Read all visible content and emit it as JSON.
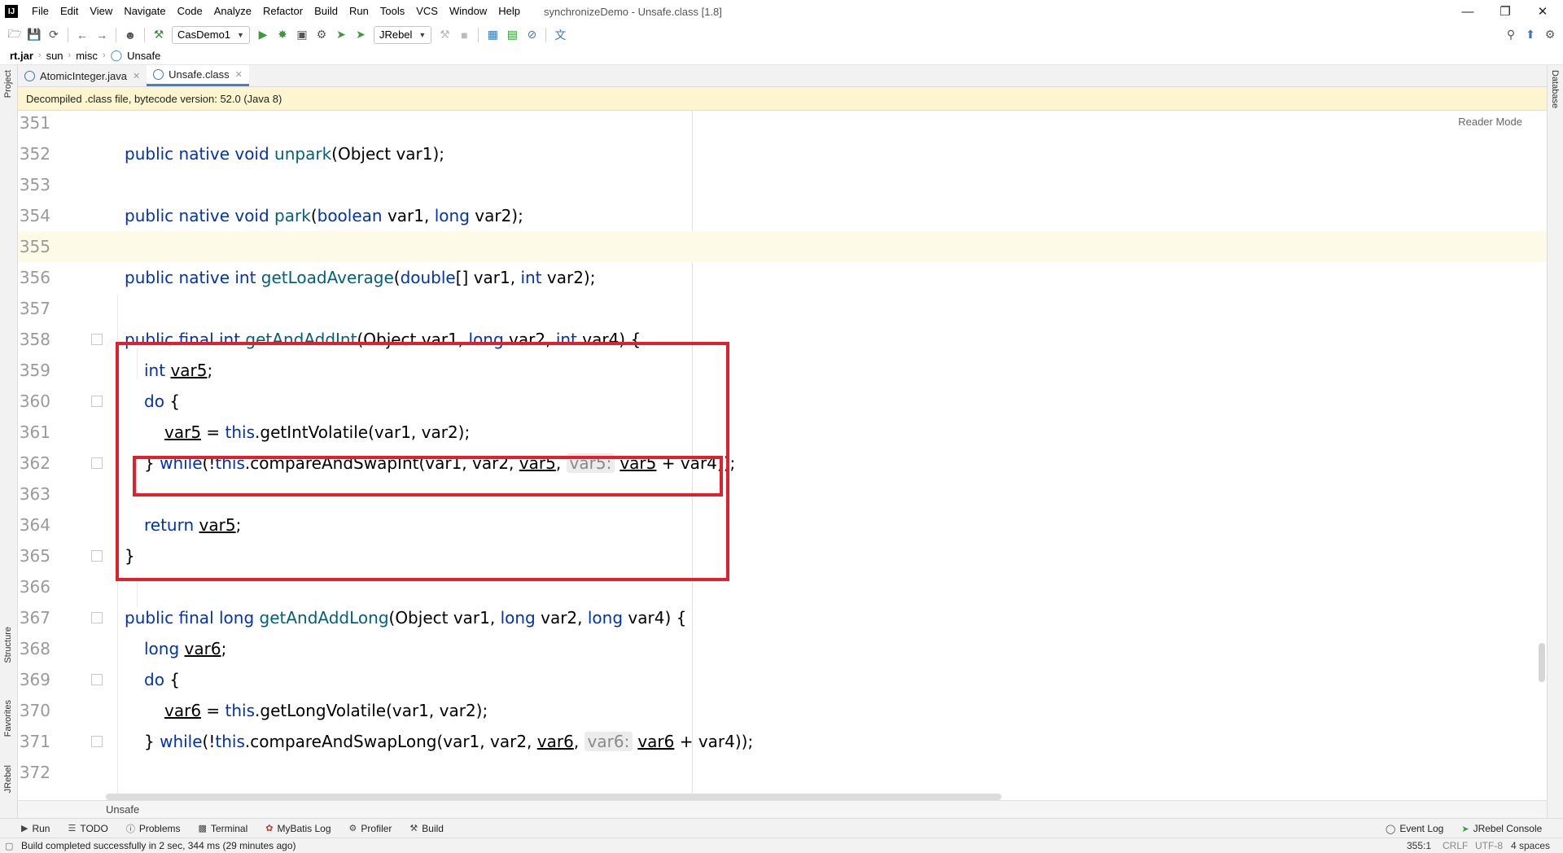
{
  "menubar": {
    "logo": "IJ",
    "items": [
      "File",
      "Edit",
      "View",
      "Navigate",
      "Code",
      "Analyze",
      "Refactor",
      "Build",
      "Run",
      "Tools",
      "VCS",
      "Window",
      "Help"
    ],
    "window_title": "synchronizeDemo - Unsafe.class [1.8]"
  },
  "toolbar": {
    "run_config": "CasDemo1",
    "jrebel_label": "JRebel"
  },
  "breadcrumb": [
    "rt.jar",
    "sun",
    "misc",
    "Unsafe"
  ],
  "tabs": [
    {
      "label": "AtomicInteger.java",
      "active": false
    },
    {
      "label": "Unsafe.class",
      "active": true
    }
  ],
  "banner": "Decompiled .class file, bytecode version: 52.0 (Java 8)",
  "reader_mode": "Reader Mode",
  "left_strip": {
    "project": "Project",
    "structure": "Structure",
    "favorites": "Favorites",
    "jrebel": "JRebel"
  },
  "right_strip": {
    "database": "Database"
  },
  "editor": {
    "line_numbers": [
      "351",
      "352",
      "353",
      "354",
      "355",
      "356",
      "357",
      "358",
      "359",
      "360",
      "361",
      "362",
      "363",
      "364",
      "365",
      "366",
      "367",
      "368",
      "369",
      "370",
      "371",
      "372"
    ],
    "lines": {
      "l352": {
        "t1": "public native void ",
        "t2": "unpark",
        "t3": "(Object var1);"
      },
      "l354": {
        "t1": "public native void ",
        "t2": "park",
        "t3": "(",
        "t4": "boolean",
        "t5": " var1, ",
        "t6": "long",
        "t7": " var2);"
      },
      "l356": {
        "t1": "public native int ",
        "t2": "getLoadAverage",
        "t3": "(",
        "t4": "double",
        "t5": "[] var1, ",
        "t6": "int",
        "t7": " var2);"
      },
      "l358": {
        "t1": "public final int ",
        "t2": "getAndAddInt",
        "t3": "(Object var1, ",
        "t4": "long",
        "t5": " var2, ",
        "t6": "int",
        "t7": " var4) {"
      },
      "l359": {
        "t1": "int ",
        "t2": "var5",
        "t3": ";"
      },
      "l360": {
        "t1": "do",
        "t2": " {"
      },
      "l361": {
        "t1": "var5",
        "t2": " = ",
        "t3": "this",
        "t4": ".getIntVolatile(var1, var2);"
      },
      "l362": {
        "t1": "} ",
        "t2": "while",
        "t3": "(!",
        "t4": "this",
        "t5": ".compareAndSwapInt(var1, var2, ",
        "t6": "var5",
        "t7": ", ",
        "hint": "var5:",
        "t8": "var5",
        "t9": " + var4));"
      },
      "l364": {
        "t1": "return ",
        "t2": "var5",
        "t3": ";"
      },
      "l365": {
        "t1": "}"
      },
      "l367": {
        "t1": "public final long ",
        "t2": "getAndAddLong",
        "t3": "(Object var1, ",
        "t4": "long",
        "t5": " var2, ",
        "t6": "long",
        "t7": " var4) {"
      },
      "l368": {
        "t1": "long ",
        "t2": "var6",
        "t3": ";"
      },
      "l369": {
        "t1": "do",
        "t2": " {"
      },
      "l370": {
        "t1": "var6",
        "t2": " = ",
        "t3": "this",
        "t4": ".getLongVolatile(var1, var2);"
      },
      "l371": {
        "t1": "} ",
        "t2": "while",
        "t3": "(!",
        "t4": "this",
        "t5": ".compareAndSwapLong(var1, var2, ",
        "t6": "var6",
        "t7": ", ",
        "hint": "var6:",
        "t8": "var6",
        "t9": " + var4));"
      }
    }
  },
  "code_crumb": "Unsafe",
  "tool_windows": [
    "Run",
    "TODO",
    "Problems",
    "Terminal",
    "MyBatis Log",
    "Profiler",
    "Build"
  ],
  "tool_windows_right": [
    "Event Log",
    "JRebel Console"
  ],
  "status": {
    "message": "Build completed successfully in 2 sec, 344 ms (29 minutes ago)",
    "position": "355:1",
    "line_sep": "CRLF",
    "encoding": "UTF-8",
    "indent": "4 spaces"
  },
  "colors": {
    "keyword": "#0033b3",
    "method": "#00627a",
    "highlight_box": "#e0202a",
    "banner_bg": "#fdf5d0"
  }
}
